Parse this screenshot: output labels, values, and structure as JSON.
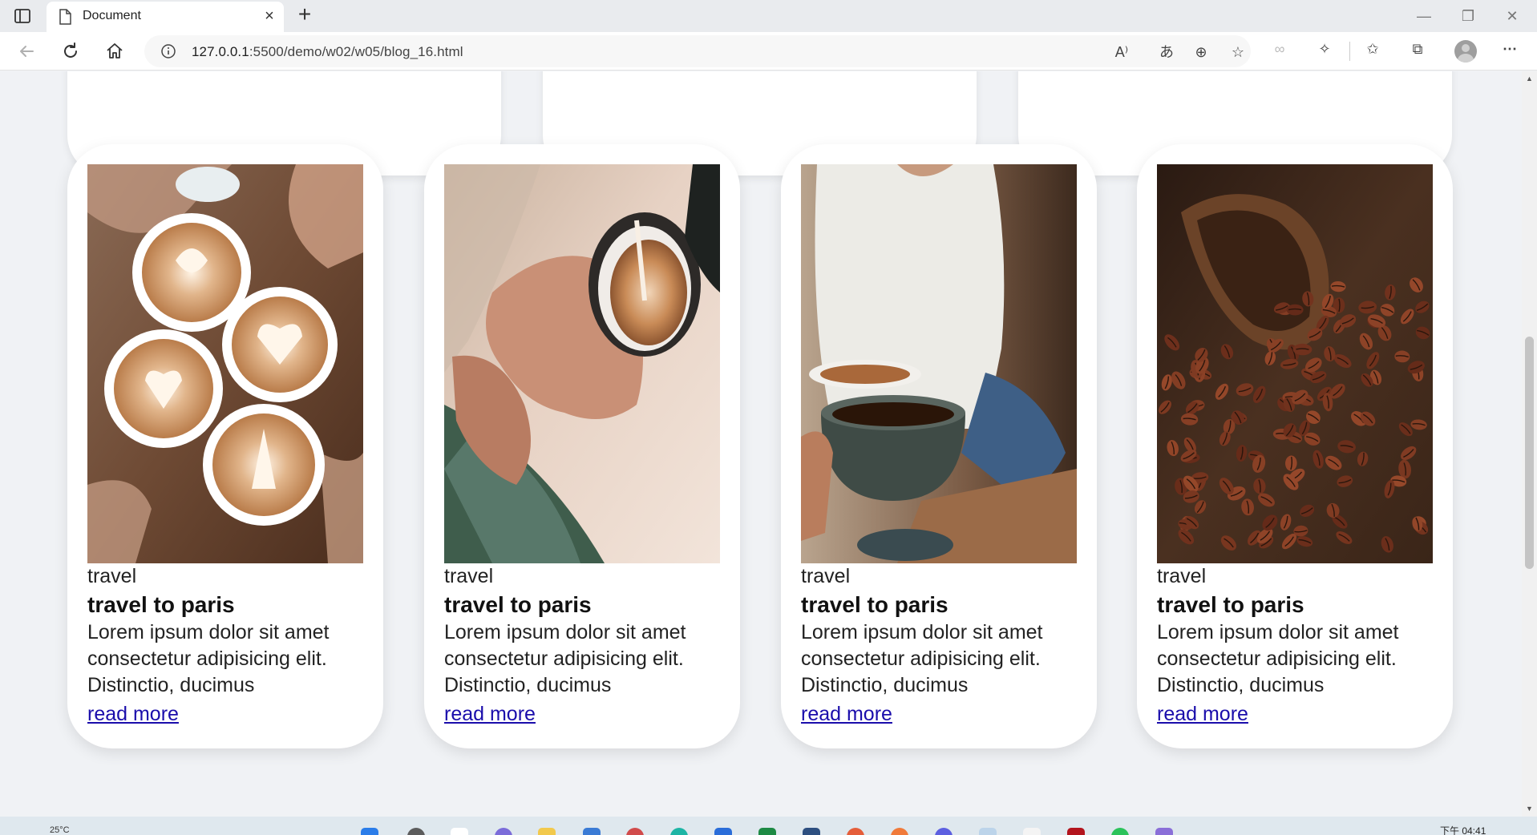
{
  "browser": {
    "tab_title": "Document",
    "url_host": "127.0.0.1",
    "url_path": ":5500/demo/w02/w05/blog_16.html"
  },
  "taskbar": {
    "weather": "25°C",
    "time": "下午 04:41"
  },
  "cards": [
    {
      "image": "latte-art-cups-photo",
      "category": "travel",
      "title": "travel to paris",
      "description": "Lorem ipsum dolor sit amet consectetur adipisicing elit. Distinctio, ducimus",
      "link": "read more"
    },
    {
      "image": "pouring-milk-coffee-photo",
      "category": "travel",
      "title": "travel to paris",
      "description": "Lorem ipsum dolor sit amet consectetur adipisicing elit. Distinctio, ducimus",
      "link": "read more"
    },
    {
      "image": "man-holding-coffee-cup-photo",
      "category": "travel",
      "title": "travel to paris",
      "description": "Lorem ipsum dolor sit amet consectetur adipisicing elit. Distinctio, ducimus",
      "link": "read more"
    },
    {
      "image": "coffee-beans-photo",
      "category": "travel",
      "title": "travel to paris",
      "description": "Lorem ipsum dolor sit amet consectetur adipisicing elit. Distinctio, ducimus",
      "link": "read more"
    }
  ],
  "colors": {
    "page_bg": "#f0f2f5",
    "card_bg": "#ffffff",
    "link": "#1a0dab"
  }
}
